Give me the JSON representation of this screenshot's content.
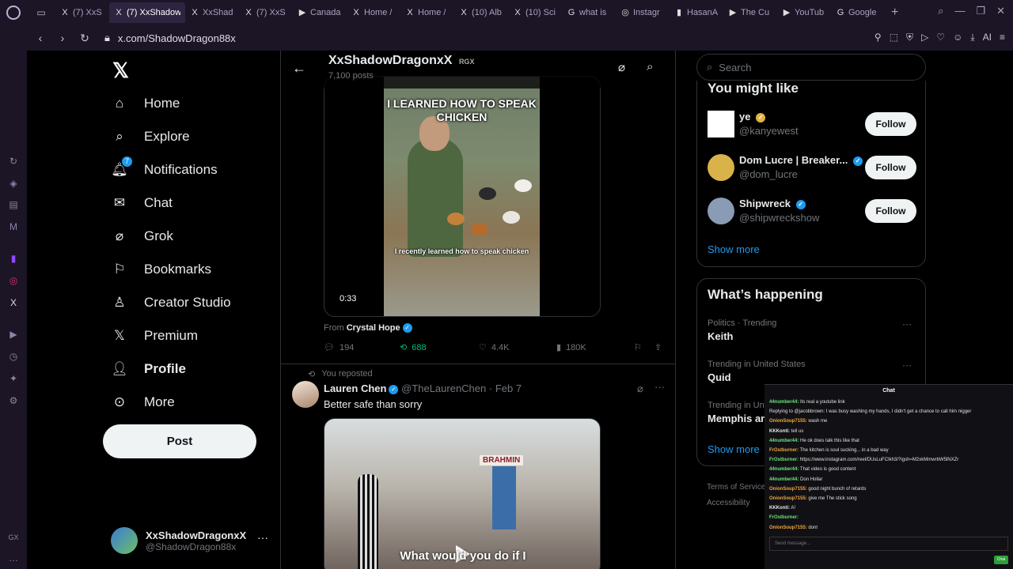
{
  "browser": {
    "tabs": [
      {
        "label": "(7) XxS",
        "fav": "X"
      },
      {
        "label": "(7) XxShadowD",
        "fav": "X"
      },
      {
        "label": "XxShad",
        "fav": "X"
      },
      {
        "label": "(7) XxS",
        "fav": "X"
      },
      {
        "label": "Canada",
        "fav": "▶"
      },
      {
        "label": "Home /",
        "fav": "X"
      },
      {
        "label": "Home /",
        "fav": "X"
      },
      {
        "label": "(10) Alb",
        "fav": "X"
      },
      {
        "label": "(10) Sci",
        "fav": "X"
      },
      {
        "label": "what is",
        "fav": "G"
      },
      {
        "label": "Instagr",
        "fav": "◎"
      },
      {
        "label": "HasanA",
        "fav": "▮"
      },
      {
        "label": "The Cu",
        "fav": "▶"
      },
      {
        "label": "YouTub",
        "fav": "▶"
      },
      {
        "label": "Google",
        "fav": "G"
      }
    ],
    "url": "x.com/ShadowDragon88x",
    "ai_label": "AI"
  },
  "nav": {
    "items": [
      {
        "label": "Home",
        "icon": "home-icon"
      },
      {
        "label": "Explore",
        "icon": "search-icon"
      },
      {
        "label": "Notifications",
        "icon": "bell-icon",
        "badge": "7"
      },
      {
        "label": "Chat",
        "icon": "mail-icon"
      },
      {
        "label": "Grok",
        "icon": "grok-icon"
      },
      {
        "label": "Bookmarks",
        "icon": "bookmark-icon"
      },
      {
        "label": "Creator Studio",
        "icon": "creator-studio-icon"
      },
      {
        "label": "Premium",
        "icon": "x-icon"
      },
      {
        "label": "Profile",
        "icon": "person-icon"
      },
      {
        "label": "More",
        "icon": "more-circle-icon"
      }
    ],
    "post_label": "Post",
    "account": {
      "name": "XxShadowDragonxX",
      "handle": "@ShadowDragon88x"
    }
  },
  "header": {
    "name": "XxShadowDragonxX",
    "tag": "RGX",
    "posts": "7,100 posts"
  },
  "post1": {
    "video_title": "I LEARNED HOW TO SPEAK CHICKEN",
    "caption": "I recently learned how to speak chicken",
    "duration": "0:33",
    "from_prefix": "From",
    "from_name": "Crystal Hope",
    "replies": "194",
    "reposts": "688",
    "likes": "4.4K",
    "views": "180K"
  },
  "post2": {
    "repost_label": "You reposted",
    "name": "Lauren Chen",
    "handle": "@TheLaurenChen",
    "date": "· Feb 7",
    "text": "Better safe than sorry",
    "sign": "BRAHMIN",
    "caption": "What would you do if I"
  },
  "right": {
    "search_placeholder": "Search",
    "might_like_title": "You might like",
    "suggestions": [
      {
        "name": "ye",
        "handle": "@kanyewest",
        "follow": "Follow"
      },
      {
        "name": "Dom Lucre | Breaker...",
        "handle": "@dom_lucre",
        "follow": "Follow"
      },
      {
        "name": "Shipwreck",
        "handle": "@shipwreckshow",
        "follow": "Follow"
      }
    ],
    "show_more": "Show more",
    "happening_title": "What’s happening",
    "trends": [
      {
        "category": "Politics · Trending",
        "name": "Keith"
      },
      {
        "category": "Trending in United States",
        "name": "Quid"
      },
      {
        "category": "Trending in Uni",
        "name": "Memphis an"
      }
    ],
    "show_more_2": "Show more",
    "footer_1": "Terms of Service",
    "footer_2": "Accessibility"
  },
  "chat": {
    "title": "Chat",
    "lines": [
      {
        "user": "44number44:",
        "text": " Its real a youtube link",
        "cls": ""
      },
      {
        "user": "",
        "text": "Replying to @jacobbrown: I was busy washing my hands, I didn't get a chance to call him nigger",
        "cls": ""
      },
      {
        "user": "OnionSoup7155:",
        "text": " wash me",
        "cls": "o"
      },
      {
        "user": "KKKonti:",
        "text": " tell us",
        "cls": "k"
      },
      {
        "user": "44number44:",
        "text": " He ok does talk this like that",
        "cls": ""
      },
      {
        "user": "FrOstburner:",
        "text": " The kitchen is soul sucking... in a bad way",
        "cls": "o"
      },
      {
        "user": "FrOstburner:",
        "text": " https://www.instagram.com/reel/DUsLuFCIkh3/?igsh=M2xkMmwrbW5lNXZr",
        "cls": ""
      },
      {
        "user": "44number44:",
        "text": " That video is good content",
        "cls": ""
      },
      {
        "user": "44number44:",
        "text": " Don Hollar",
        "cls": ""
      },
      {
        "user": "OnionSoup7155:",
        "text": " good night bunch of retards",
        "cls": "o"
      },
      {
        "user": "OnionSoup7155:",
        "text": " give me The stick song",
        "cls": "o"
      },
      {
        "user": "KKKonti:",
        "text": " A!",
        "cls": "k"
      },
      {
        "user": "FrOstburner:",
        "text": " ",
        "cls": ""
      },
      {
        "user": "OnionSoup7155:",
        "text": " dont",
        "cls": "o"
      }
    ],
    "input_placeholder": "Send message...",
    "send_label": "Chat"
  }
}
